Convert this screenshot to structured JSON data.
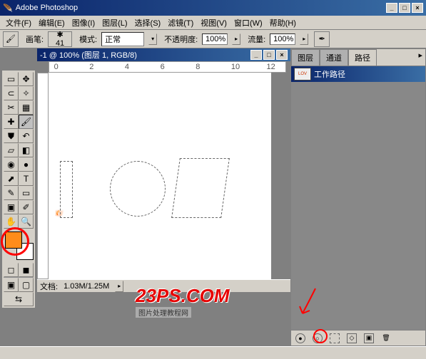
{
  "app": {
    "title": "Adobe Photoshop"
  },
  "menu": [
    "文件(F)",
    "编辑(E)",
    "图像(I)",
    "图层(L)",
    "选择(S)",
    "滤镜(T)",
    "视图(V)",
    "窗口(W)",
    "帮助(H)"
  ],
  "options": {
    "brush_lbl": "画笔:",
    "brush_size": "41",
    "mode_lbl": "模式:",
    "mode_val": "正常",
    "opacity_lbl": "不透明度:",
    "opacity_val": "100%",
    "flow_lbl": "流量:",
    "flow_val": "100%"
  },
  "doc": {
    "title": "-1 @ 100% (图层 1, RGB/8)"
  },
  "ruler": {
    "t0": "0",
    "t2": "2",
    "t4": "4",
    "t6": "6",
    "t8": "8",
    "t10": "10",
    "t12": "12"
  },
  "status": {
    "doc_label": "文档:",
    "doc_size": "1.03M/1.25M"
  },
  "panel": {
    "tabs": {
      "layers": "图层",
      "channels": "通道",
      "paths": "路径"
    },
    "path_name": "工作路径"
  },
  "colors": {
    "fg": "#ff8c1a",
    "bg": "#ffffff"
  },
  "canvas_text": {
    "l": "L",
    "o": "O",
    "v": "V"
  },
  "watermark": {
    "main": "23PS.COM",
    "sub": "图片处理教程网"
  }
}
